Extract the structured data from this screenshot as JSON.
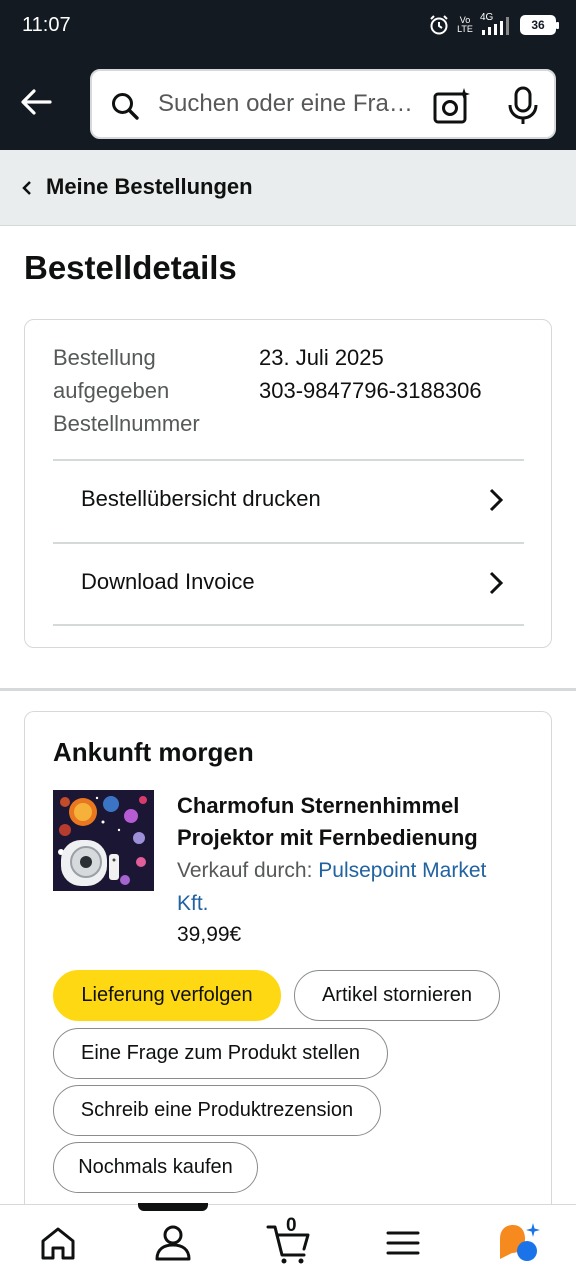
{
  "status_bar": {
    "time": "11:07",
    "network": "4G",
    "volte": "Vo LTE",
    "battery": "36"
  },
  "header": {
    "search_placeholder": "Suchen oder eine Frage stellen"
  },
  "breadcrumb": {
    "label": "Meine Bestellungen"
  },
  "page": {
    "title": "Bestelldetails"
  },
  "order_info": {
    "placed_label_line1": "Bestellung",
    "placed_label_line2": "aufgegeben",
    "number_label": "Bestellnummer",
    "placed_value": "23. Juli 2025",
    "number_value": "303-9847796-3188306",
    "links": [
      {
        "label": "Bestellübersicht drucken"
      },
      {
        "label": "Download Invoice"
      }
    ]
  },
  "shipment": {
    "arrival_title": "Ankunft morgen",
    "product": {
      "title_line1": "Charmofun Sternenhimmel",
      "title_line2": "Projektor mit Fernbedienung",
      "seller_prefix": "Verkauf durch:",
      "seller_name_line1": "Pulsepoint Market",
      "seller_name_line2": "Kft.",
      "price": "39,99€"
    },
    "actions": {
      "track": "Lieferung verfolgen",
      "cancel": "Artikel stornieren",
      "question": "Eine Frage zum Produkt stellen",
      "review": "Schreib eine Produktrezension",
      "buy_again": "Nochmals kaufen"
    }
  },
  "bottom_nav": {
    "cart_count": "0",
    "items": [
      "home-icon",
      "profile-icon",
      "cart-icon",
      "menu-icon",
      "rufus-assistant-icon"
    ]
  },
  "colors": {
    "header_bg": "#131a22",
    "primary_button": "#ffd814",
    "link": "#2162a1",
    "breadcrumb_bg": "#eaeded"
  }
}
